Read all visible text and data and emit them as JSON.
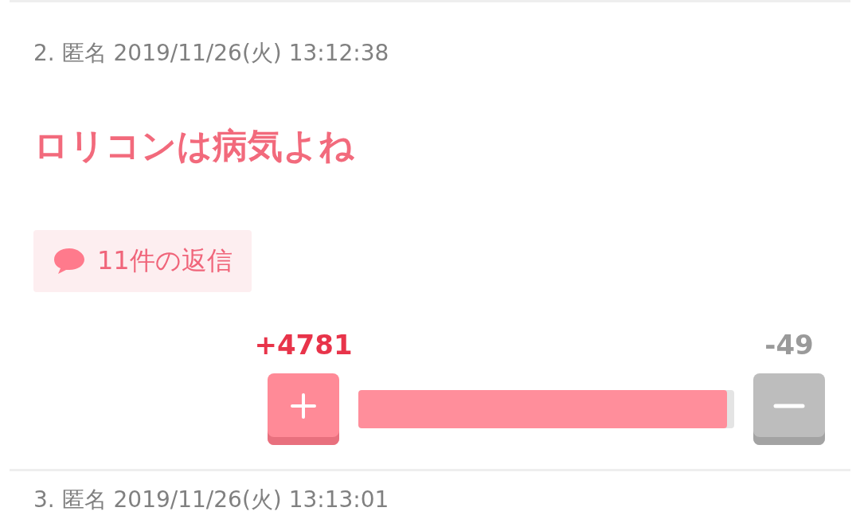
{
  "posts": [
    {
      "meta": "2. 匿名 2019/11/26(火) 13:12:38",
      "title": "ロリコンは病気よね",
      "replies": "11件の返信",
      "plus": "+4781",
      "minus": "-49",
      "level": 0.98
    },
    {
      "meta": "3. 匿名 2019/11/26(火) 13:13:01"
    }
  ]
}
